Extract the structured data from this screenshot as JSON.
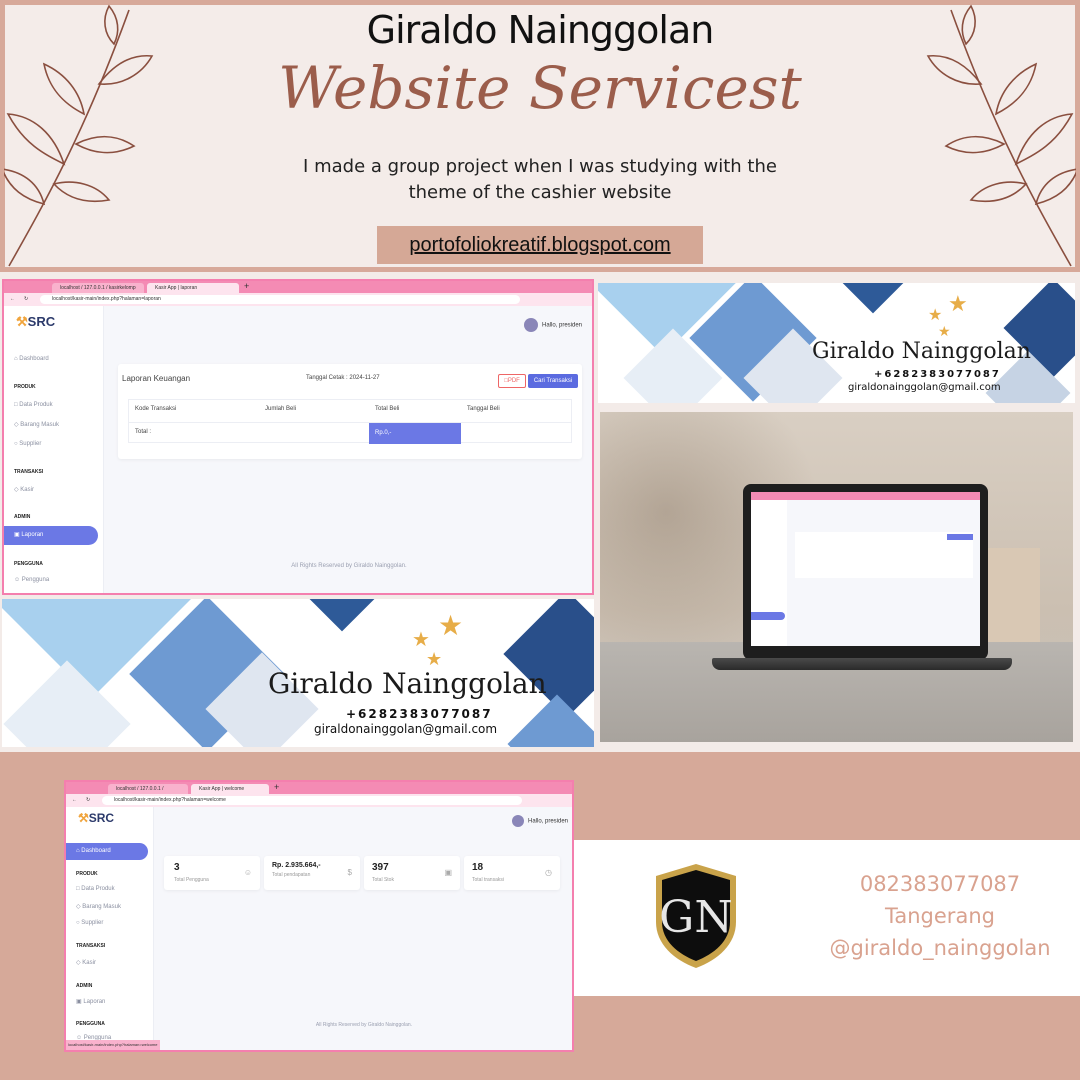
{
  "header": {
    "name": "Giraldo Nainggolan",
    "script_title": "Website Servicest",
    "description": "I made a group project when I was studying with the theme of the cashier website",
    "blog_url": "portofoliokreatif.blogspot.com"
  },
  "laporan_screen": {
    "tabs": [
      "localhost / 127.0.0.1 / kasirkelomp",
      "Kasir App | laporan"
    ],
    "url": "localhost/kasir-main/index.php?halaman=laporan",
    "hello": "Hallo, presiden",
    "sidebar": {
      "dashboard": "Dashboard",
      "sec_produk": "PRODUK",
      "data_produk": "Data Produk",
      "barang_masuk": "Barang Masuk",
      "supplier": "Supplier",
      "sec_transaksi": "TRANSAKSI",
      "kasir": "Kasir",
      "sec_admin": "ADMIN",
      "laporan": "Laporan",
      "sec_pengguna": "PENGGUNA",
      "pengguna": "Pengguna"
    },
    "report": {
      "title": "Laporan Keuangan",
      "print_date": "Tanggal Cetak : 2024-11-27",
      "pdf_label": "PDF",
      "search_label": "Cari Transaksi",
      "columns": [
        "Kode Transaksi",
        "Jumlah Beli",
        "Total Beli",
        "Tanggal Beli"
      ],
      "total_label": "Total :",
      "total_value": "Rp.0,-"
    },
    "footer": "All Rights Reserved by Giraldo Nainggolan."
  },
  "dashboard_screen": {
    "tabs": [
      "localhost / 127.0.0.1 / kasirkelom",
      "Kasir App | welcome"
    ],
    "url": "localhost/kasir-main/index.php?halaman=welcome",
    "hello": "Hallo, presiden",
    "status_url": "localhost/kasir-main/index.php?halaman=welcome",
    "sidebar": {
      "dashboard": "Dashboard",
      "sec_produk": "PRODUK",
      "data_produk": "Data Produk",
      "barang_masuk": "Barang Masuk",
      "supplier": "Supplier",
      "sec_transaksi": "TRANSAKSI",
      "kasir": "Kasir",
      "sec_admin": "ADMIN",
      "laporan": "Laporan",
      "sec_pengguna": "PENGGUNA",
      "pengguna": "Pengguna"
    },
    "stats": [
      {
        "value": "3",
        "label": "Total Pengguna"
      },
      {
        "value": "Rp. 2.935.664,-",
        "label": "Total pendapatan"
      },
      {
        "value": "397",
        "label": "Total Stok"
      },
      {
        "value": "18",
        "label": "Total transaksi"
      }
    ],
    "footer": "All Rights Reserved by Giraldo Nainggolan."
  },
  "banner": {
    "name": "Giraldo Nainggolan",
    "phone": "+6282383077087",
    "email": "giraldonainggolan@gmail.com"
  },
  "contact": {
    "monogram": "GN",
    "phone": "082383077087",
    "city": "Tangerang",
    "handle": "@giraldo_nainggolan"
  },
  "colors": {
    "accent_pink": "#f47fae",
    "sidebar_active": "#6b78e5",
    "rose": "#d6a999",
    "script_brown": "#9b5d4b"
  }
}
